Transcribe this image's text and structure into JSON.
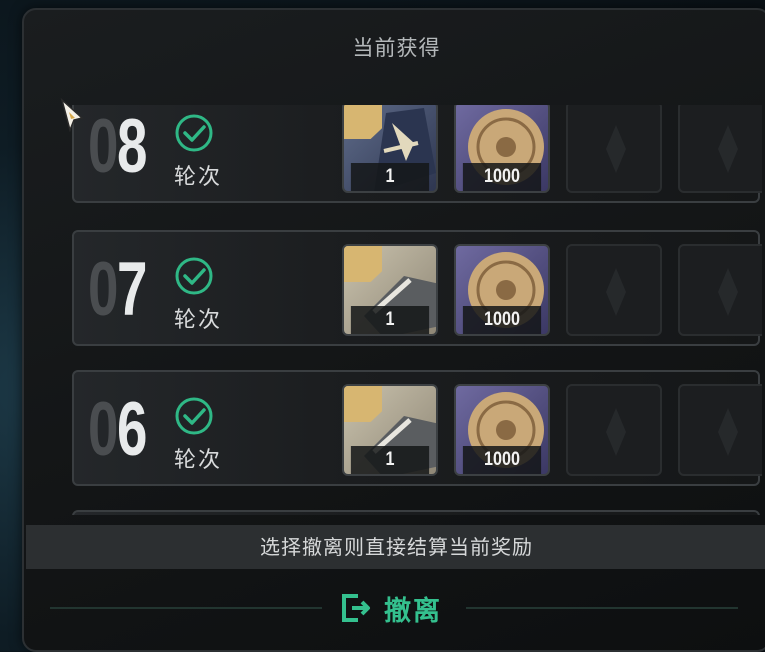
{
  "panel": {
    "title": "当前获得"
  },
  "rounds": [
    {
      "number": "08",
      "label": "轮次",
      "status": "completed",
      "rewards": [
        {
          "kind": "item",
          "icon": "sword-medal-icon",
          "qty": "1"
        },
        {
          "kind": "coin",
          "icon": "coin-icon",
          "qty": "1000"
        }
      ]
    },
    {
      "number": "07",
      "label": "轮次",
      "status": "completed",
      "rewards": [
        {
          "kind": "item",
          "icon": "blade-item-icon",
          "qty": "1"
        },
        {
          "kind": "coin",
          "icon": "coin-icon",
          "qty": "1000"
        }
      ]
    },
    {
      "number": "06",
      "label": "轮次",
      "status": "completed",
      "rewards": [
        {
          "kind": "item",
          "icon": "blade-item-icon",
          "qty": "1"
        },
        {
          "kind": "coin",
          "icon": "coin-icon",
          "qty": "1000"
        }
      ]
    }
  ],
  "notice": "选择撤离则直接结算当前奖励",
  "evacuate": {
    "label": "撤离",
    "icon": "exit-icon"
  },
  "colors": {
    "accent": "#34c08e",
    "check": "#2fb886",
    "tag": "#d7b671"
  }
}
